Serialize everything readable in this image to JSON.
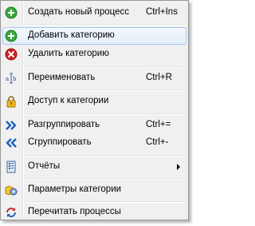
{
  "menu": {
    "items": [
      {
        "label": "Создать новый процесс",
        "shortcut": "Ctrl+Ins",
        "icon": "plus-circle-green-icon"
      },
      {
        "label": "Добавить категорию",
        "shortcut": "",
        "icon": "plus-circle-green-icon"
      },
      {
        "label": "Удалить категорию",
        "shortcut": "",
        "icon": "delete-circle-red-icon"
      },
      {
        "label": "Переименовать",
        "shortcut": "Ctrl+R",
        "icon": "rename-icon"
      },
      {
        "label": "Доступ к категории",
        "shortcut": "",
        "icon": "padlock-icon"
      },
      {
        "label": "Разгруппировать",
        "shortcut": "Ctrl+=",
        "icon": "double-chevron-right-icon"
      },
      {
        "label": "Сгруппировать",
        "shortcut": "Ctrl+-",
        "icon": "double-chevron-left-icon"
      },
      {
        "label": "Отчёты",
        "shortcut": "",
        "icon": "report-icon",
        "submenu": true
      },
      {
        "label": "Параметры категории",
        "shortcut": "",
        "icon": "category-settings-icon"
      },
      {
        "label": "Перечитать процессы",
        "shortcut": "",
        "icon": "reload-icon"
      }
    ]
  },
  "colors": {
    "menu_background": "#f0f0f0",
    "highlight_border": "#a8c8eb",
    "add_green": "#2e9e32",
    "delete_red": "#d42020",
    "chevron_blue": "#1f5fbf"
  }
}
